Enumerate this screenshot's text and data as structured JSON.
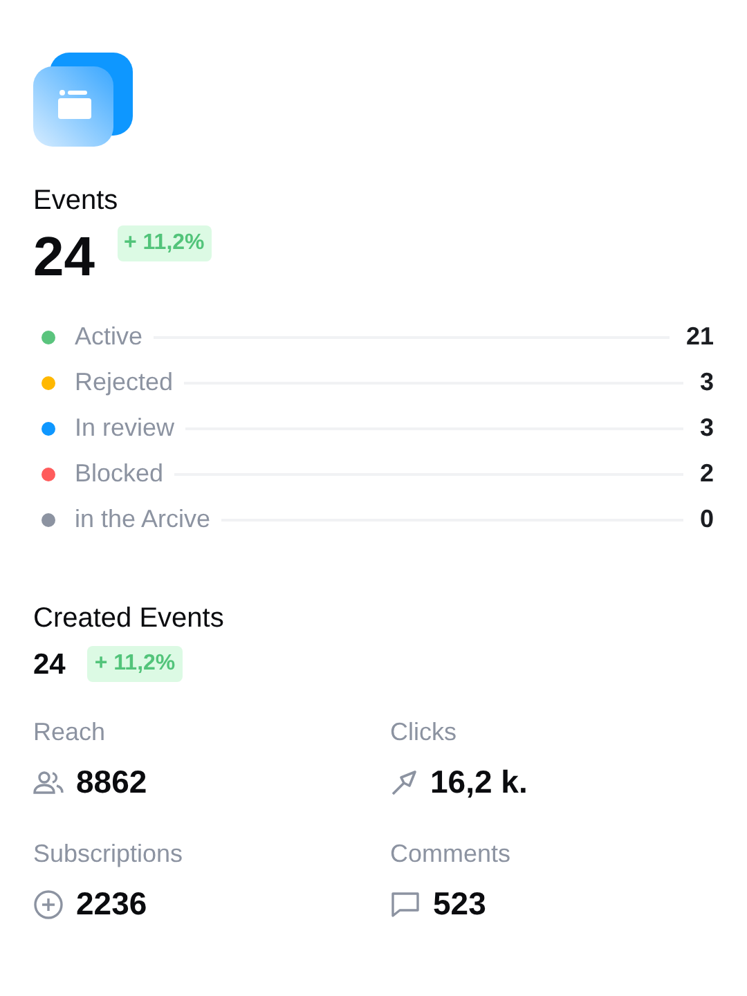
{
  "events": {
    "title": "Events",
    "total": "24",
    "change": "+ 11,2%"
  },
  "statuses": [
    {
      "label": "Active",
      "count": "21",
      "color": "#5ac47d"
    },
    {
      "label": "Rejected",
      "count": "3",
      "color": "#ffb800"
    },
    {
      "label": "In review",
      "count": "3",
      "color": "#0e97ff"
    },
    {
      "label": "Blocked",
      "count": "2",
      "color": "#ff5c5c"
    },
    {
      "label": "in the Arcive",
      "count": "0",
      "color": "#8c93a1"
    }
  ],
  "created": {
    "title": "Created Events",
    "total": "24",
    "change": "+ 11,2%"
  },
  "metrics": [
    {
      "label": "Reach",
      "value": "8862",
      "kind": "people"
    },
    {
      "label": "Clicks",
      "value": "16,2 k.",
      "kind": "send"
    },
    {
      "label": "Subscriptions",
      "value": "2236",
      "kind": "plus"
    },
    {
      "label": "Comments",
      "value": "523",
      "kind": "comment"
    }
  ]
}
